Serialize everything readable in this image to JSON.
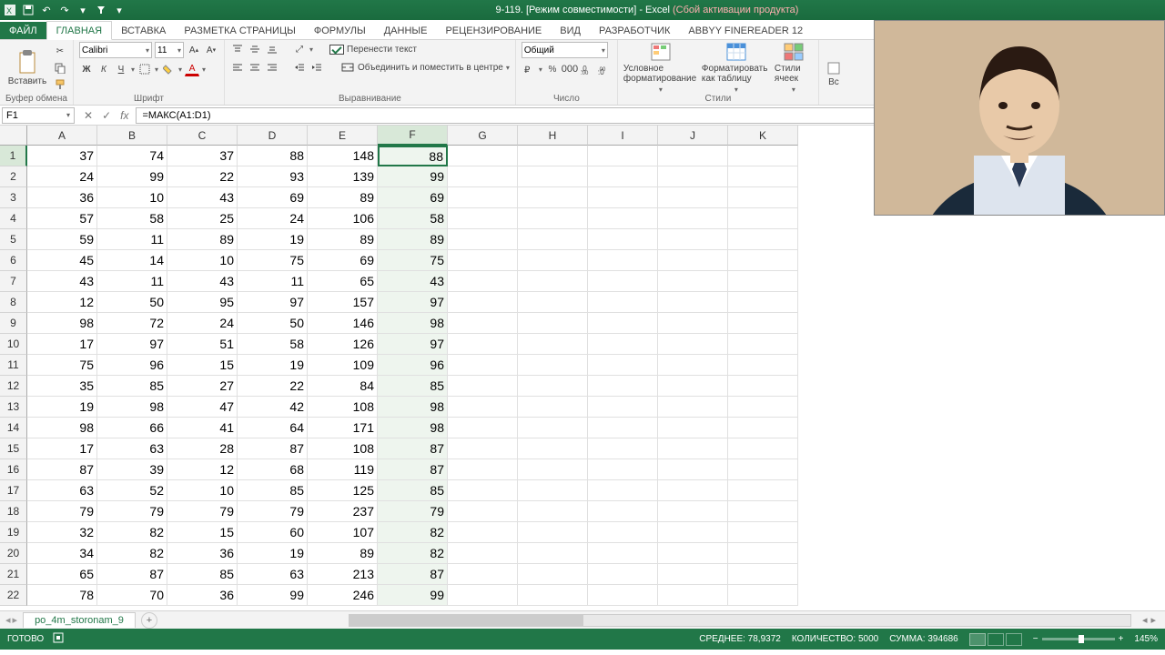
{
  "title": {
    "doc": "9-119.",
    "mode": " [Режим совместимости] ",
    "app": "- Excel",
    "warn": "(Сбой активации продукта)"
  },
  "ribbon_tabs": [
    "ФАЙЛ",
    "ГЛАВНАЯ",
    "ВСТАВКА",
    "РАЗМЕТКА СТРАНИЦЫ",
    "ФОРМУЛЫ",
    "ДАННЫЕ",
    "РЕЦЕНЗИРОВАНИЕ",
    "ВИД",
    "РАЗРАБОТЧИК",
    "ABBYY FineReader 12"
  ],
  "groups": {
    "clipboard": {
      "label": "Буфер обмена",
      "paste": "Вставить"
    },
    "font": {
      "label": "Шрифт",
      "name": "Calibri",
      "size": "11",
      "bold": "Ж",
      "italic": "К",
      "underline": "Ч"
    },
    "align": {
      "label": "Выравнивание",
      "wrap": "Перенести текст",
      "merge": "Объединить и поместить в центре"
    },
    "number": {
      "label": "Число",
      "format": "Общий"
    },
    "styles": {
      "label": "Стили",
      "cond": "Условное форматирование",
      "table": "Форматировать как таблицу",
      "cell": "Стили ячеек"
    },
    "cells": {
      "ins": "Вс"
    }
  },
  "name_box": "F1",
  "formula": "=МАКС(A1:D1)",
  "columns": [
    "A",
    "B",
    "C",
    "D",
    "E",
    "F",
    "G",
    "H",
    "I",
    "J",
    "K"
  ],
  "rows": [
    {
      "n": 1,
      "d": [
        37,
        74,
        37,
        88,
        148,
        88
      ]
    },
    {
      "n": 2,
      "d": [
        24,
        99,
        22,
        93,
        139,
        99
      ]
    },
    {
      "n": 3,
      "d": [
        36,
        10,
        43,
        69,
        89,
        69
      ]
    },
    {
      "n": 4,
      "d": [
        57,
        58,
        25,
        24,
        106,
        58
      ]
    },
    {
      "n": 5,
      "d": [
        59,
        11,
        89,
        19,
        89,
        89
      ]
    },
    {
      "n": 6,
      "d": [
        45,
        14,
        10,
        75,
        69,
        75
      ]
    },
    {
      "n": 7,
      "d": [
        43,
        11,
        43,
        11,
        65,
        43
      ]
    },
    {
      "n": 8,
      "d": [
        12,
        50,
        95,
        97,
        157,
        97
      ]
    },
    {
      "n": 9,
      "d": [
        98,
        72,
        24,
        50,
        146,
        98
      ]
    },
    {
      "n": 10,
      "d": [
        17,
        97,
        51,
        58,
        126,
        97
      ]
    },
    {
      "n": 11,
      "d": [
        75,
        96,
        15,
        19,
        109,
        96
      ]
    },
    {
      "n": 12,
      "d": [
        35,
        85,
        27,
        22,
        84,
        85
      ]
    },
    {
      "n": 13,
      "d": [
        19,
        98,
        47,
        42,
        108,
        98
      ]
    },
    {
      "n": 14,
      "d": [
        98,
        66,
        41,
        64,
        171,
        98
      ]
    },
    {
      "n": 15,
      "d": [
        17,
        63,
        28,
        87,
        108,
        87
      ]
    },
    {
      "n": 16,
      "d": [
        87,
        39,
        12,
        68,
        119,
        87
      ]
    },
    {
      "n": 17,
      "d": [
        63,
        52,
        10,
        85,
        125,
        85
      ]
    },
    {
      "n": 18,
      "d": [
        79,
        79,
        79,
        79,
        237,
        79
      ]
    },
    {
      "n": 19,
      "d": [
        32,
        82,
        15,
        60,
        107,
        82
      ]
    },
    {
      "n": 20,
      "d": [
        34,
        82,
        36,
        19,
        89,
        82
      ]
    },
    {
      "n": 21,
      "d": [
        65,
        87,
        85,
        63,
        213,
        87
      ]
    },
    {
      "n": 22,
      "d": [
        78,
        70,
        36,
        99,
        246,
        99
      ]
    }
  ],
  "sheet_tab": "po_4m_storonam_9",
  "status": {
    "ready": "ГОТОВО",
    "avg": "СРЕДНЕЕ: 78,9372",
    "count": "КОЛИЧЕСТВО: 5000",
    "sum": "СУММА: 394686",
    "zoom": "145%"
  }
}
